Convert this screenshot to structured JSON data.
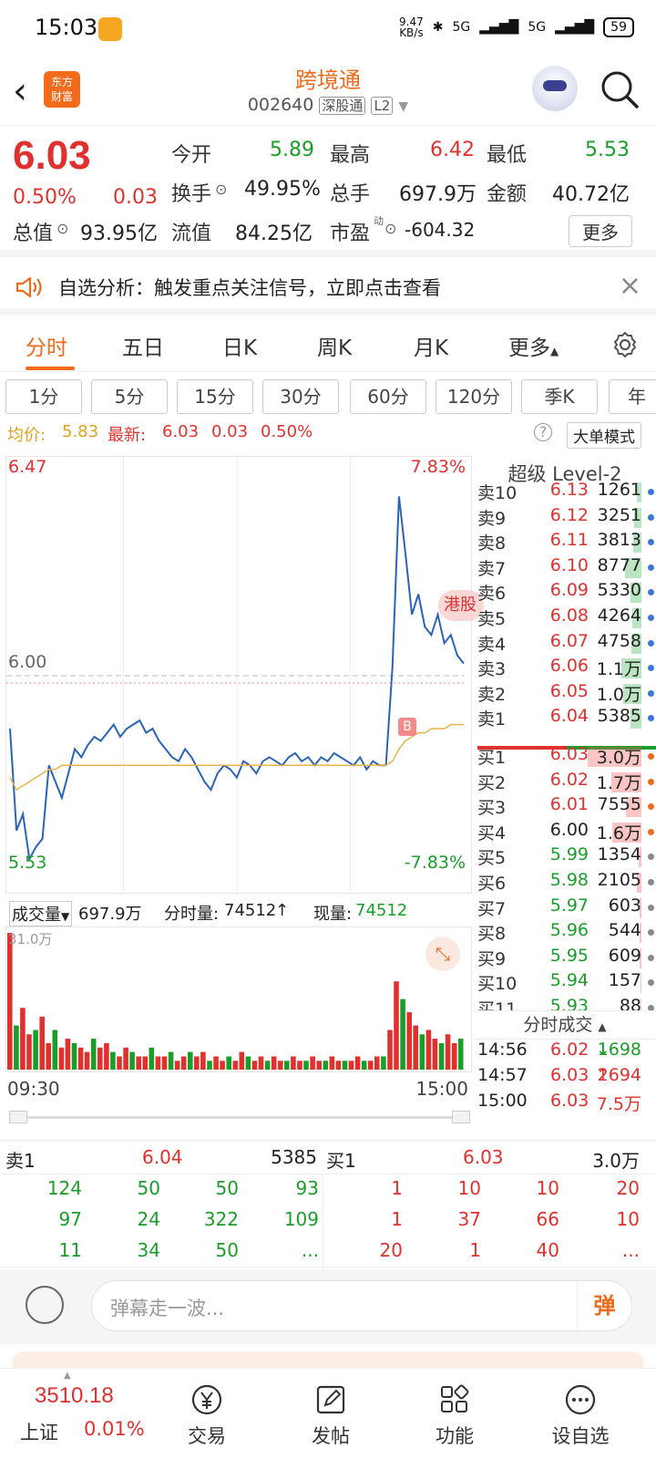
{
  "status": {
    "time": "15:03",
    "net_speed": "9.47\nKB/s",
    "signal1": "5G",
    "signal2": "5G",
    "battery": "59"
  },
  "header": {
    "logo_text": "东方财富",
    "title": "跨境通",
    "code": "002640",
    "market": "深股通",
    "level": "L2"
  },
  "quote": {
    "price": "6.03",
    "pct": "0.50%",
    "chg": "0.03",
    "row1": [
      {
        "label": "今开",
        "value": "5.89"
      },
      {
        "label": "最高",
        "value": "6.42"
      },
      {
        "label": "最低",
        "value": "5.53"
      }
    ],
    "row2": [
      {
        "label": "换手",
        "value": "49.95%"
      },
      {
        "label": "总手",
        "value": "697.9万"
      },
      {
        "label": "金额",
        "value": "40.72亿"
      }
    ],
    "row3": [
      {
        "label": "总值",
        "value": "93.95亿"
      },
      {
        "label": "流值",
        "value": "84.25亿"
      },
      {
        "label": "市盈",
        "sup": "动",
        "value": "-604.32"
      }
    ],
    "more": "更多"
  },
  "notice": {
    "text": "自选分析：触发重点关注信号，立即点击查看"
  },
  "tabs": [
    "分时",
    "五日",
    "日K",
    "周K",
    "月K",
    "更多"
  ],
  "periods": [
    "1分",
    "5分",
    "15分",
    "30分",
    "60分",
    "120分",
    "季K",
    "年"
  ],
  "avg": {
    "avg_label": "均价:",
    "avg_value": "5.83",
    "latest_label": "最新:",
    "latest_value": "6.03",
    "chg": "0.03",
    "pct": "0.50%",
    "mode": "大单模式"
  },
  "chart": {
    "top_price": "6.47",
    "top_pct": "7.83%",
    "mid_price": "6.00",
    "bot_price": "5.53",
    "bot_pct": "-7.83%",
    "badge": "港股",
    "b_marker": "B",
    "chart_data": {
      "type": "line",
      "xlabel": "",
      "ylabel": "",
      "ylim": [
        5.53,
        6.47
      ],
      "x_range": [
        "09:30",
        "15:00"
      ],
      "reference": 6.0,
      "series": [
        {
          "values": [
            5.87,
            5.62,
            5.66,
            5.55,
            5.58,
            5.6,
            5.78,
            5.74,
            5.7,
            5.76,
            5.82,
            5.8,
            5.83,
            5.85,
            5.84,
            5.86,
            5.88,
            5.85,
            5.87,
            5.88,
            5.89,
            5.86,
            5.87,
            5.84,
            5.82,
            5.8,
            5.79,
            5.82,
            5.8,
            5.77,
            5.74,
            5.72,
            5.76,
            5.78,
            5.77,
            5.75,
            5.79,
            5.78,
            5.76,
            5.79,
            5.8,
            5.79,
            5.78,
            5.8,
            5.81,
            5.79,
            5.8,
            5.78,
            5.8,
            5.79,
            5.81,
            5.8,
            5.79,
            5.78,
            5.8,
            5.77,
            5.79,
            5.78,
            5.78,
            6.02,
            6.44,
            6.3,
            6.15,
            6.2,
            6.12,
            6.1,
            6.15,
            6.08,
            6.1,
            6.05,
            6.03
          ]
        },
        {
          "values": [
            5.75,
            5.72,
            5.73,
            5.74,
            5.75,
            5.76,
            5.77,
            5.77,
            5.78,
            5.78,
            5.78,
            5.78,
            5.78,
            5.78,
            5.78,
            5.78,
            5.78,
            5.78,
            5.78,
            5.78,
            5.78,
            5.78,
            5.78,
            5.78,
            5.78,
            5.78,
            5.78,
            5.78,
            5.78,
            5.78,
            5.78,
            5.78,
            5.78,
            5.78,
            5.78,
            5.78,
            5.78,
            5.78,
            5.78,
            5.78,
            5.78,
            5.78,
            5.78,
            5.78,
            5.78,
            5.78,
            5.78,
            5.78,
            5.78,
            5.78,
            5.78,
            5.78,
            5.78,
            5.78,
            5.78,
            5.78,
            5.78,
            5.78,
            5.78,
            5.79,
            5.82,
            5.84,
            5.85,
            5.86,
            5.86,
            5.87,
            5.87,
            5.87,
            5.88,
            5.88,
            5.88
          ]
        }
      ]
    }
  },
  "level2": {
    "title": "超级 Level-2",
    "asks": [
      {
        "label": "卖10",
        "price": "6.13",
        "vol": "1261",
        "bar": 0.08
      },
      {
        "label": "卖9",
        "price": "6.12",
        "vol": "3251",
        "bar": 0.12
      },
      {
        "label": "卖8",
        "price": "6.11",
        "vol": "3813",
        "bar": 0.14
      },
      {
        "label": "卖7",
        "price": "6.10",
        "vol": "8777",
        "bar": 0.28
      },
      {
        "label": "卖6",
        "price": "6.09",
        "vol": "5330",
        "bar": 0.18
      },
      {
        "label": "卖5",
        "price": "6.08",
        "vol": "4264",
        "bar": 0.15
      },
      {
        "label": "卖4",
        "price": "6.07",
        "vol": "4758",
        "bar": 0.16
      },
      {
        "label": "卖3",
        "price": "6.06",
        "vol": "1.1万",
        "bar": 0.33
      },
      {
        "label": "卖2",
        "price": "6.05",
        "vol": "1.0万",
        "bar": 0.31
      },
      {
        "label": "卖1",
        "price": "6.04",
        "vol": "5385",
        "bar": 0.18
      }
    ],
    "bids": [
      {
        "label": "买1",
        "price": "6.03",
        "vol": "3.0万",
        "color": "red",
        "bar": 0.9
      },
      {
        "label": "买2",
        "price": "6.02",
        "vol": "1.7万",
        "color": "red",
        "bar": 0.5
      },
      {
        "label": "买3",
        "price": "6.01",
        "vol": "7555",
        "color": "red",
        "bar": 0.25
      },
      {
        "label": "买4",
        "price": "6.00",
        "vol": "1.6万",
        "color": "black",
        "bar": 0.48
      },
      {
        "label": "买5",
        "price": "5.99",
        "vol": "1354",
        "color": "green",
        "bar": 0.05
      },
      {
        "label": "买6",
        "price": "5.98",
        "vol": "2105",
        "color": "green",
        "bar": 0.07
      },
      {
        "label": "买7",
        "price": "5.97",
        "vol": "603",
        "color": "green",
        "bar": 0.03
      },
      {
        "label": "买8",
        "price": "5.96",
        "vol": "544",
        "color": "green",
        "bar": 0.03
      },
      {
        "label": "买9",
        "price": "5.95",
        "vol": "609",
        "color": "green",
        "bar": 0.03
      },
      {
        "label": "买10",
        "price": "5.94",
        "vol": "157",
        "color": "green",
        "bar": 0.02
      },
      {
        "label": "买11",
        "price": "5.93",
        "vol": "88",
        "color": "green",
        "bar": 0.01
      }
    ],
    "trades_title": "分时成交",
    "trades": [
      {
        "time": "14:56",
        "price": "6.02",
        "arrow": "↓",
        "vol": "1698"
      },
      {
        "time": "14:57",
        "price": "6.03",
        "arrow": "↑",
        "vol": "2694"
      },
      {
        "time": "15:00",
        "price": "6.03",
        "arrow": "",
        "vol": "7.5万"
      }
    ]
  },
  "volume": {
    "label": "成交量",
    "total": "697.9万",
    "fenshi_label": "分时量:",
    "fenshi_value": "74512",
    "xian_label": "现量:",
    "xian_value": "74512",
    "scale": "31.0万",
    "chart_data": {
      "type": "bar",
      "ylim": [
        0,
        31
      ],
      "values": [
        31,
        10,
        14,
        8,
        9,
        12,
        6,
        9,
        5,
        7,
        6,
        5,
        4,
        7,
        5,
        6,
        4,
        3,
        5,
        4,
        3,
        3,
        5,
        3,
        3,
        4,
        2,
        3,
        4,
        3,
        4,
        2,
        3,
        2,
        3,
        2,
        4,
        3,
        2,
        3,
        2,
        3,
        2,
        2,
        3,
        2,
        2,
        3,
        2,
        2,
        3,
        2,
        2,
        2,
        3,
        2,
        2,
        3,
        3,
        9,
        20,
        16,
        13,
        10,
        8,
        9,
        7,
        6,
        8,
        6,
        7
      ]
    },
    "time_start": "09:30",
    "time_end": "15:00"
  },
  "orders": {
    "sell_label": "卖1",
    "sell_price": "6.04",
    "sell_vol": "5385",
    "buy_label": "买1",
    "buy_price": "6.03",
    "buy_vol": "3.0万",
    "sell_rows": [
      [
        "124",
        "50",
        "50",
        "93"
      ],
      [
        "97",
        "24",
        "322",
        "109"
      ],
      [
        "11",
        "34",
        "50",
        "..."
      ]
    ],
    "buy_rows": [
      [
        "1",
        "10",
        "10",
        "20"
      ],
      [
        "1",
        "37",
        "66",
        "10"
      ],
      [
        "20",
        "1",
        "40",
        "..."
      ]
    ]
  },
  "comment": {
    "placeholder": "弹幕走一波...",
    "dan": "弹"
  },
  "bottom_nav": {
    "index_value": "3510.18",
    "index_name": "上证",
    "index_pct": "0.01%",
    "items": [
      "交易",
      "发帖",
      "功能",
      "设自选"
    ]
  }
}
